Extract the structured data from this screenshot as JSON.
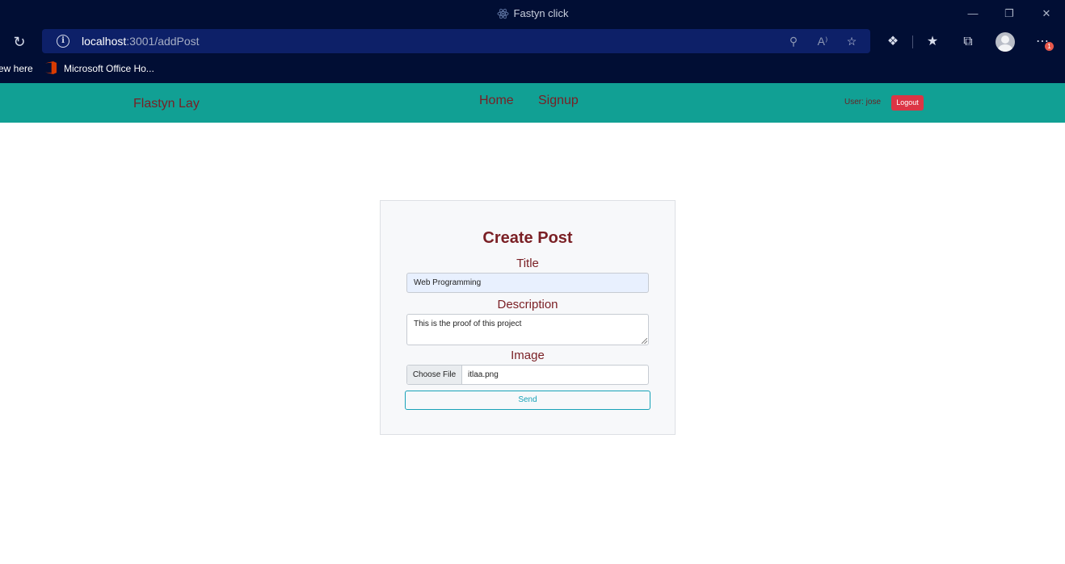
{
  "browser": {
    "window_title": "Fastyn click",
    "url_host": "localhost",
    "url_rest": ":3001/addPost",
    "notification_count": "1"
  },
  "bookmarks": {
    "items": [
      {
        "label": "ew here"
      },
      {
        "label": "Microsoft Office Ho..."
      }
    ]
  },
  "navbar": {
    "brand": "Flastyn Lay",
    "links": [
      {
        "label": "Home"
      },
      {
        "label": "Signup"
      }
    ],
    "user_text": "User: jose",
    "logout_label": "Logout"
  },
  "form": {
    "heading": "Create Post",
    "title_label": "Title",
    "title_value": "Web Programming",
    "description_label": "Description",
    "description_value": "This is the proof of this project",
    "image_label": "Image",
    "choose_file_label": "Choose File",
    "file_name": "itlaa.png",
    "send_label": "Send"
  },
  "colors": {
    "navbar_bg": "#11a094",
    "brand_text": "#7a1f24",
    "logout_bg": "#dc3545",
    "send_outline": "#17a2b8",
    "browser_chrome": "#010e34"
  }
}
